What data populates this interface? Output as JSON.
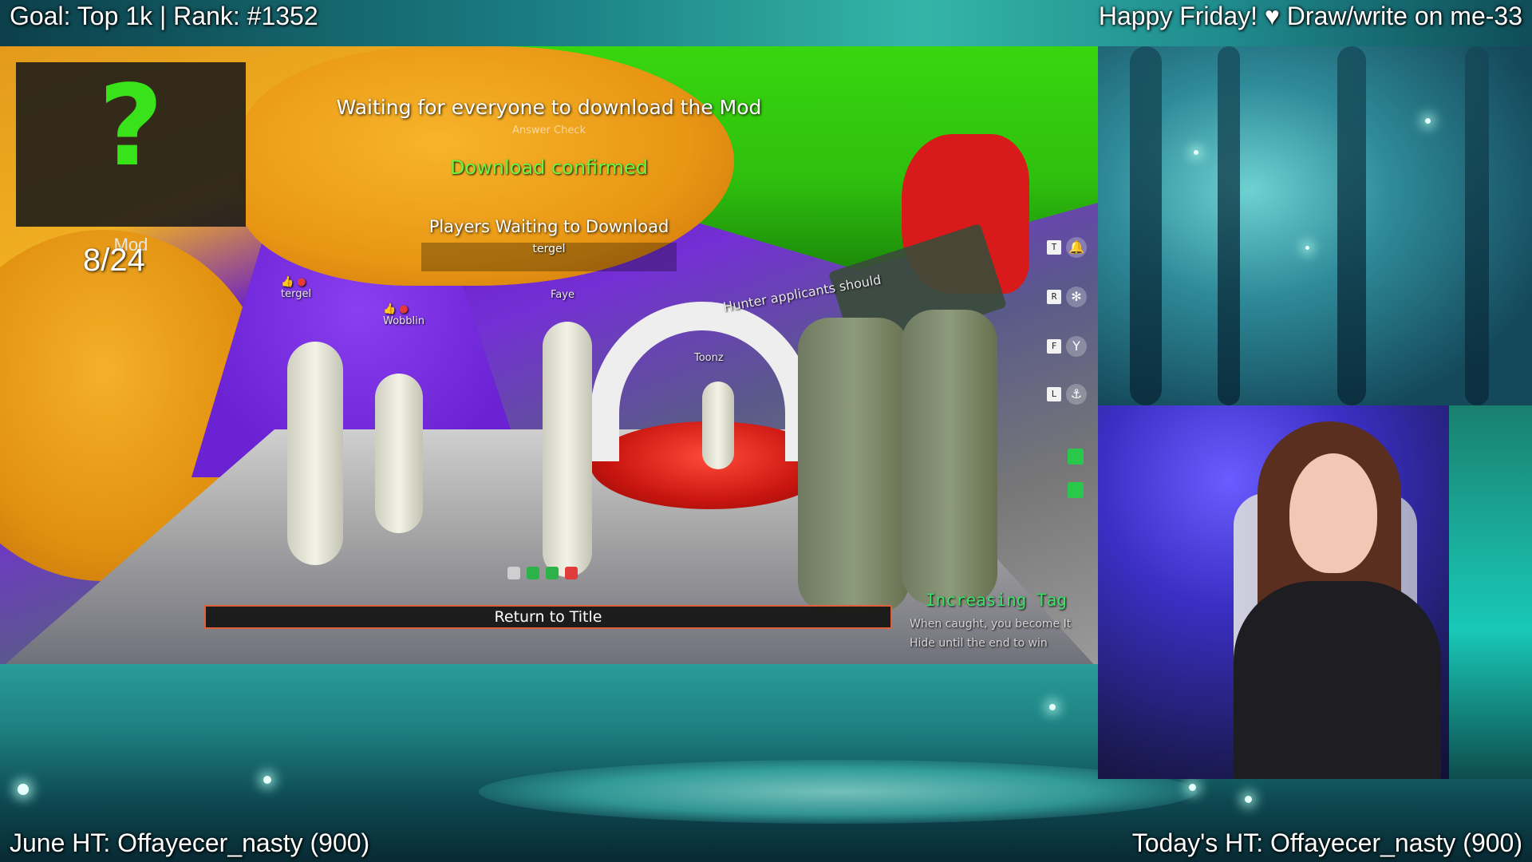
{
  "overlay": {
    "goal": "Goal: Top 1k | Rank: #1352",
    "greeting": "Happy Friday! ♥ Draw/write on me-33",
    "june_ht": "June HT: Offayecer_nasty (900)",
    "today_ht": "Today's HT: Offayecer_nasty (900)"
  },
  "game": {
    "mod_panel": {
      "icon": "question-mark-icon",
      "glyph": "?",
      "label": "Mod",
      "counter": "8/24"
    },
    "status": {
      "waiting": "Waiting for everyone to download the Mod",
      "sub": "Answer Check",
      "confirmed": "Download confirmed",
      "waiting_header": "Players Waiting to Download",
      "waiting_players": [
        "tergel"
      ]
    },
    "nametags": [
      {
        "name": "tergel"
      },
      {
        "name": "Wobblin"
      },
      {
        "name": "Faye"
      },
      {
        "name": "Toonz"
      },
      {
        "name": "Hunter applicants should"
      }
    ],
    "return_button": "Return to Title",
    "mode": {
      "title": "Increasing Tag",
      "line1": "When caught, you become It",
      "line2": "Hide until the end to win"
    },
    "side_controls": [
      {
        "key": "T",
        "icon": "bell-icon"
      },
      {
        "key": "R",
        "icon": "pose-icon"
      },
      {
        "key": "F",
        "icon": "point-icon"
      },
      {
        "key": "L",
        "icon": "anchor-icon"
      }
    ],
    "colors": {
      "mod_green": "#39e31a",
      "confirmed_green": "#6cf542",
      "button_border": "#e0603a",
      "mode_title": "#3ee06a"
    }
  }
}
